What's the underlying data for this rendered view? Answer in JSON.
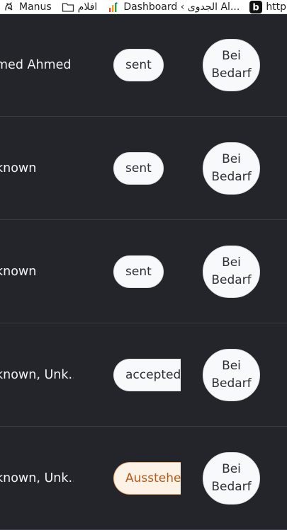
{
  "bookmarks": [
    {
      "label": "Manus",
      "icon": "manus-icon"
    },
    {
      "label": "افلام",
      "icon": "folder-icon"
    },
    {
      "label": "Dashboard ‹ الجدوى Al...",
      "icon": "bar-chart-icon"
    },
    {
      "label": "http",
      "icon": "b-logo-icon"
    }
  ],
  "rows": [
    {
      "name": "med Ahmed",
      "status": "sent",
      "schedule": [
        "Bei",
        "Bedarf"
      ]
    },
    {
      "name": "known",
      "status": "sent",
      "schedule": [
        "Bei",
        "Bedarf"
      ]
    },
    {
      "name": "known",
      "status": "sent",
      "schedule": [
        "Bei",
        "Bedarf"
      ]
    },
    {
      "name": "known, Unk...",
      "status": "accepted",
      "schedule": [
        "Bei",
        "Bedarf"
      ]
    },
    {
      "name": "known, Unk...",
      "status": "Ausstehen",
      "schedule": [
        "Bei",
        "Bedarf"
      ]
    }
  ],
  "colors": {
    "background": "#23252b",
    "pending_text": "#b45a1e",
    "pending_border": "#f2b57c",
    "pending_bg": "#fdf2e6"
  }
}
